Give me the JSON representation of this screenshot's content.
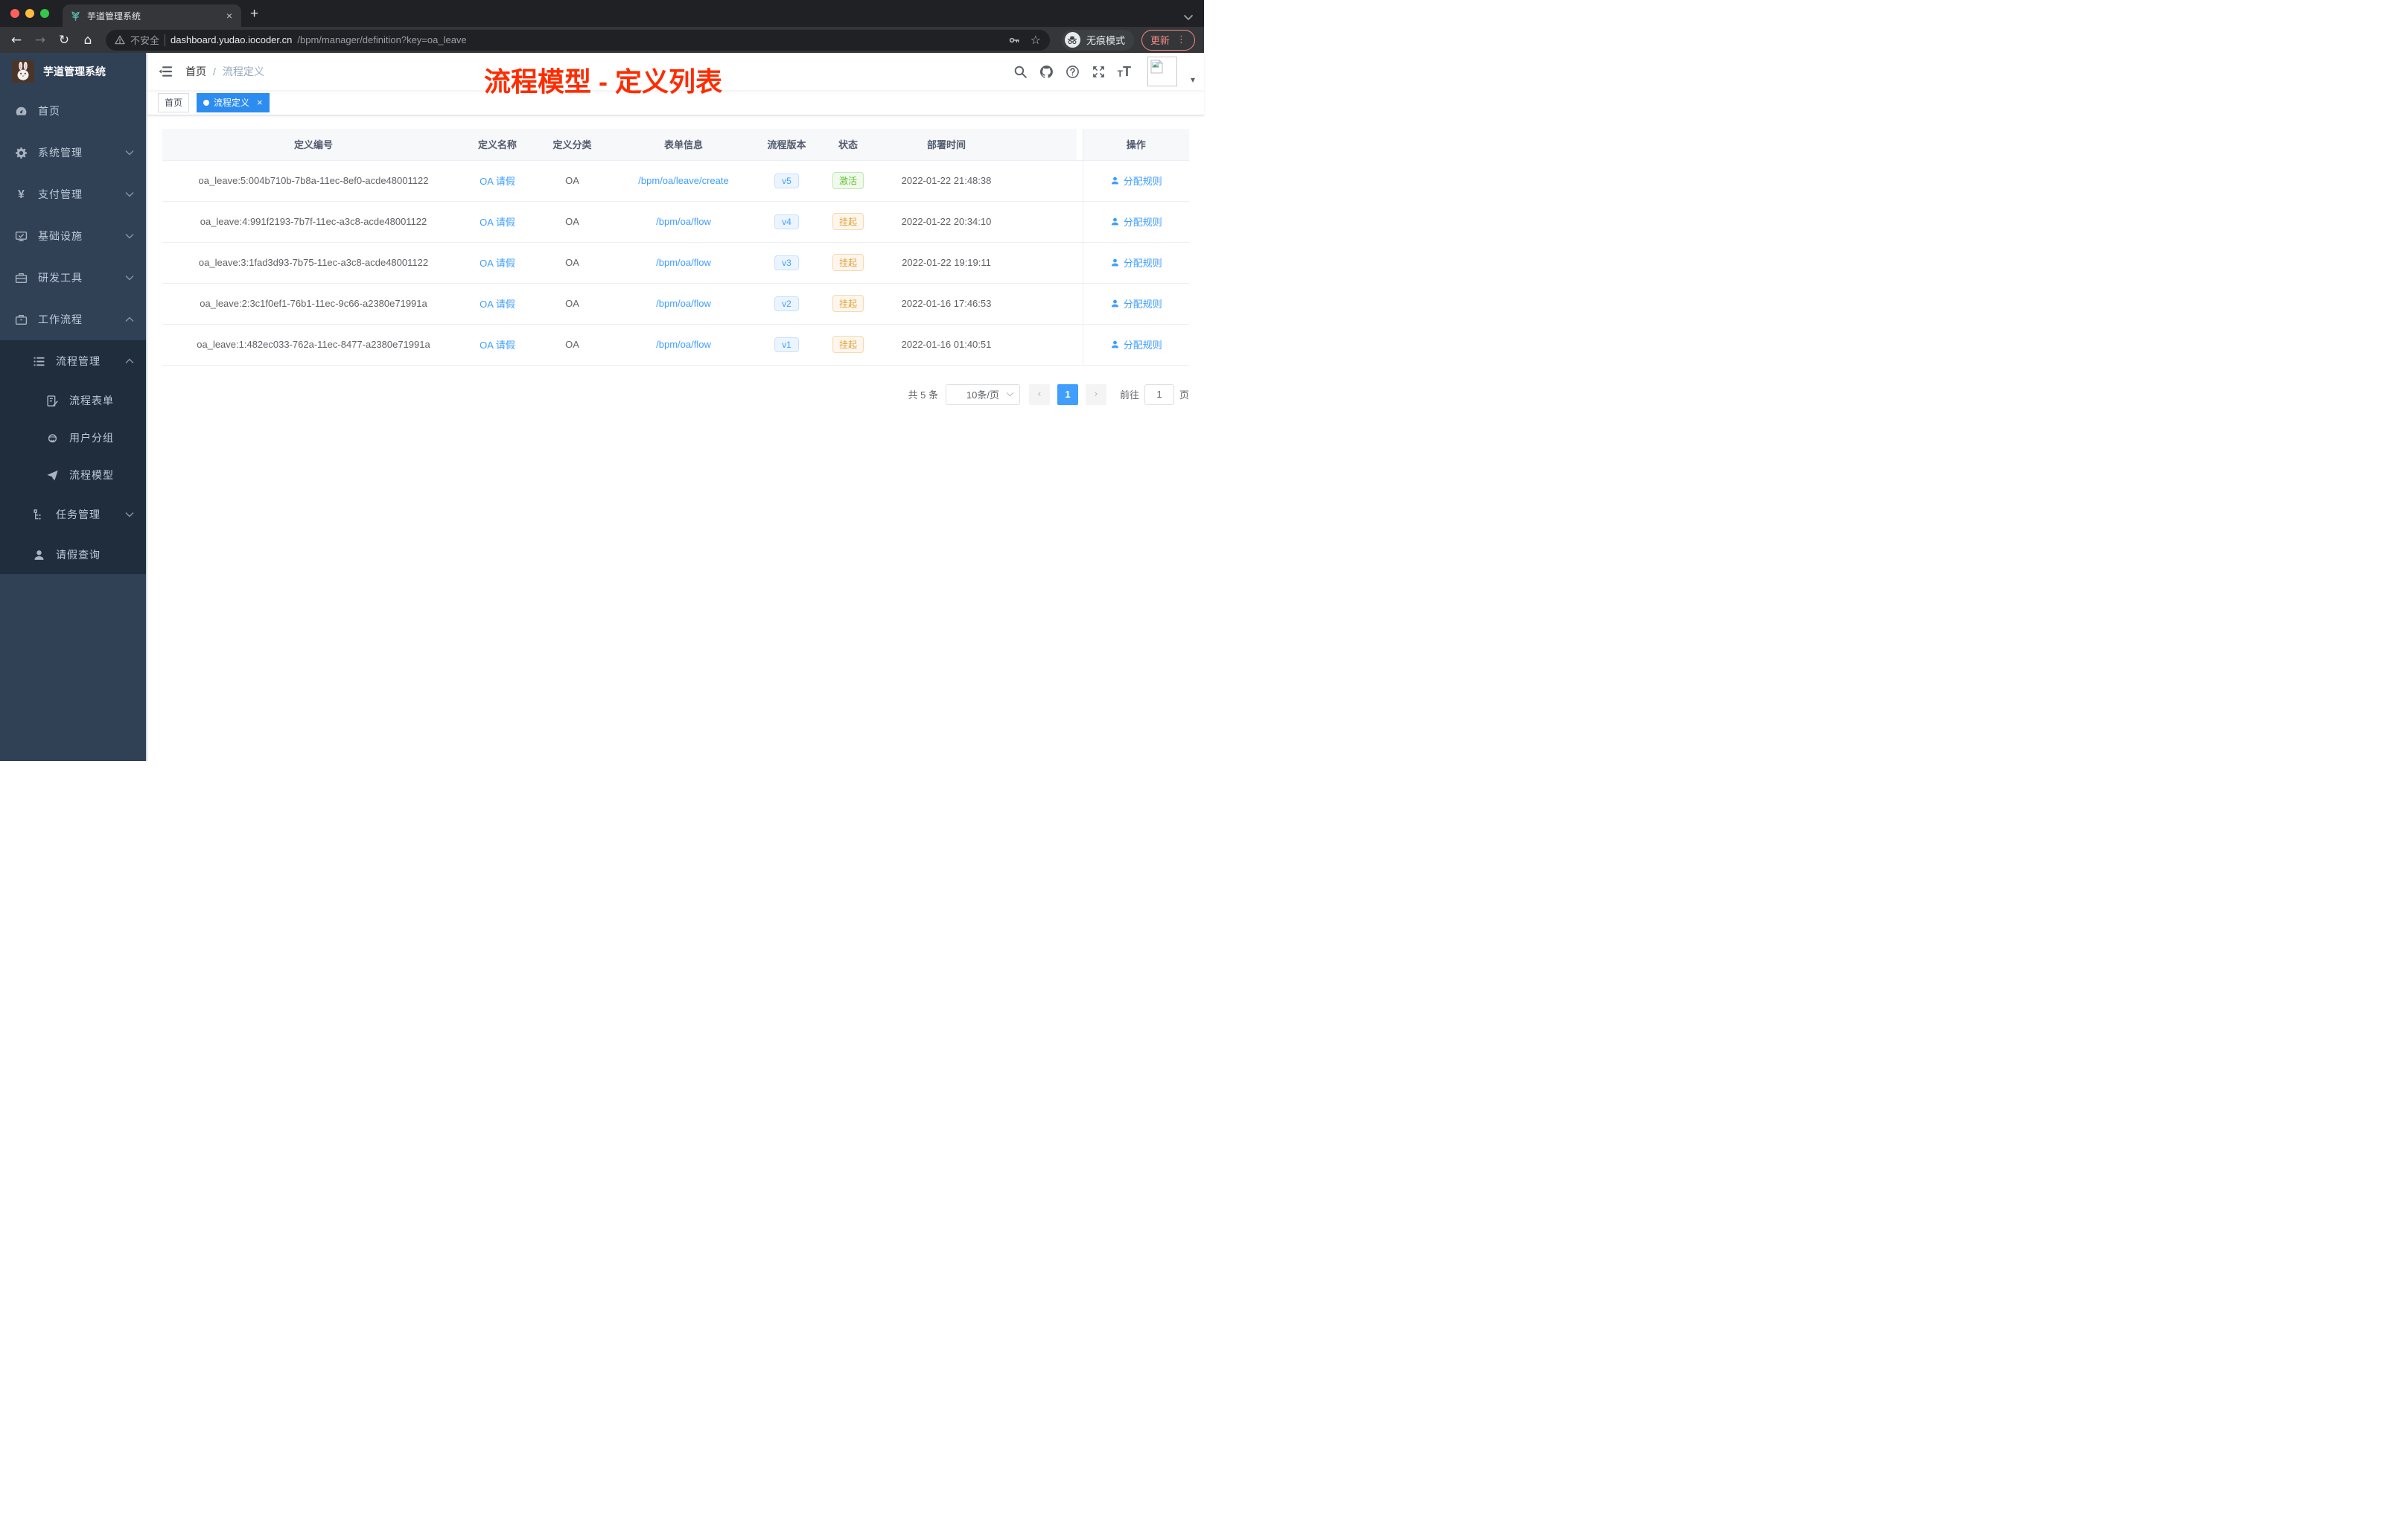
{
  "browser": {
    "tab_title": "芋道管理系统",
    "new_tab_glyph": "+",
    "close_glyph": "×",
    "security_label": "不安全",
    "url_host": "dashboard.yudao.iocoder.cn",
    "url_path": "/bpm/manager/definition?key=oa_leave",
    "incognito_label": "无痕模式",
    "update_label": "更新",
    "menu_dots": "⋮",
    "back_glyph": "←",
    "forward_glyph": "→",
    "reload_glyph": "↻",
    "home_glyph": "⌂",
    "caret_glyph": "▾"
  },
  "annotation": {
    "title": "流程模型 - 定义列表",
    "color": "#fe2c00"
  },
  "sidebar": {
    "logo_title": "芋道管理系统",
    "items": [
      {
        "label": "首页"
      },
      {
        "label": "系统管理"
      },
      {
        "label": "支付管理"
      },
      {
        "label": "基础设施"
      },
      {
        "label": "研发工具"
      },
      {
        "label": "工作流程"
      },
      {
        "label": "流程管理"
      },
      {
        "label": "流程表单"
      },
      {
        "label": "用户分组"
      },
      {
        "label": "流程模型"
      },
      {
        "label": "任务管理"
      },
      {
        "label": "请假查询"
      }
    ]
  },
  "header": {
    "breadcrumb_home": "首页",
    "breadcrumb_sep": "/",
    "breadcrumb_current": "流程定义"
  },
  "tags": [
    {
      "label": "首页"
    },
    {
      "label": "流程定义",
      "close": "×"
    }
  ],
  "table": {
    "columns": [
      "定义编号",
      "定义名称",
      "定义分类",
      "表单信息",
      "流程版本",
      "状态",
      "部署时间",
      "操作"
    ],
    "rows": [
      {
        "id": "oa_leave:5:004b710b-7b8a-11ec-8ef0-acde48001122",
        "name": "OA 请假",
        "category": "OA",
        "form": "/bpm/oa/leave/create",
        "version": "v5",
        "status": "激活",
        "deploy_time": "2022-01-22 21:48:38",
        "action": "分配规则"
      },
      {
        "id": "oa_leave:4:991f2193-7b7f-11ec-a3c8-acde48001122",
        "name": "OA 请假",
        "category": "OA",
        "form": "/bpm/oa/flow",
        "version": "v4",
        "status": "挂起",
        "deploy_time": "2022-01-22 20:34:10",
        "action": "分配规则"
      },
      {
        "id": "oa_leave:3:1fad3d93-7b75-11ec-a3c8-acde48001122",
        "name": "OA 请假",
        "category": "OA",
        "form": "/bpm/oa/flow",
        "version": "v3",
        "status": "挂起",
        "deploy_time": "2022-01-22 19:19:11",
        "action": "分配规则"
      },
      {
        "id": "oa_leave:2:3c1f0ef1-76b1-11ec-9c66-a2380e71991a",
        "name": "OA 请假",
        "category": "OA",
        "form": "/bpm/oa/flow",
        "version": "v2",
        "status": "挂起",
        "deploy_time": "2022-01-16 17:46:53",
        "action": "分配规则"
      },
      {
        "id": "oa_leave:1:482ec033-762a-11ec-8477-a2380e71991a",
        "name": "OA 请假",
        "category": "OA",
        "form": "/bpm/oa/flow",
        "version": "v1",
        "status": "挂起",
        "deploy_time": "2022-01-16 01:40:51",
        "action": "分配规则"
      }
    ]
  },
  "pagination": {
    "total": "共 5 条",
    "page_size": "10条/页",
    "prev": "‹",
    "current": "1",
    "next": "›",
    "goto_label": "前往",
    "goto_value": "1",
    "page_unit": "页"
  },
  "colors": {
    "accent": "#409eff",
    "tag_active": "#2d8cf0",
    "status_active": "#67c23a",
    "status_suspend": "#e6a23c",
    "sidebar_bg": "#304156",
    "submenu_bg": "#1f2d3d",
    "annotation_red": "#fe2c00"
  }
}
